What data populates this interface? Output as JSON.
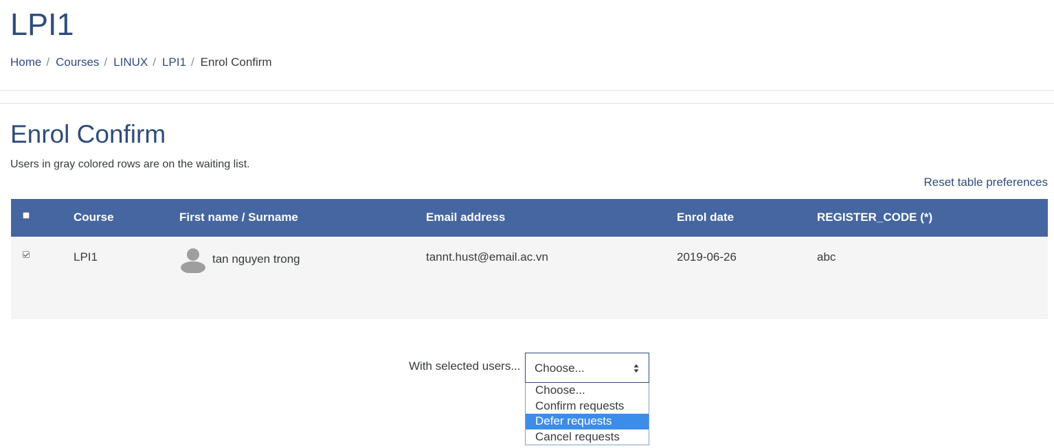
{
  "course": {
    "title": "LPI1"
  },
  "breadcrumb": {
    "items": [
      "Home",
      "Courses",
      "LINUX",
      "LPI1"
    ],
    "current": "Enrol Confirm",
    "separator": "/"
  },
  "page": {
    "heading": "Enrol Confirm",
    "waiting_note": "Users in gray colored rows are on the waiting list.",
    "reset_link": "Reset table preferences"
  },
  "table": {
    "headers": {
      "course": "Course",
      "name": "First name / Surname",
      "email": "Email address",
      "enrol_date": "Enrol date",
      "register_code": "REGISTER_CODE (*)"
    },
    "select_all_checked": false,
    "rows": [
      {
        "checked": true,
        "course": "LPI1",
        "name": "tan nguyen trong",
        "email": "tannt.hust@email.ac.vn",
        "enrol_date": "2019-06-26",
        "register_code": "abc",
        "waiting_list": true
      }
    ]
  },
  "bulk_action": {
    "label": "With selected users...",
    "selected": "Choose...",
    "options": [
      "Choose...",
      "Confirm requests",
      "Defer requests",
      "Cancel requests"
    ],
    "highlighted": "Defer requests"
  },
  "colors": {
    "brand_text": "#2f4c7c",
    "table_header": "#4566a0",
    "waiting_row": "#f5f5f5",
    "option_highlight": "#3c8dea"
  },
  "icons": {
    "avatar": "user-avatar-icon",
    "select_arrows": "up-down-chevron-icon"
  }
}
